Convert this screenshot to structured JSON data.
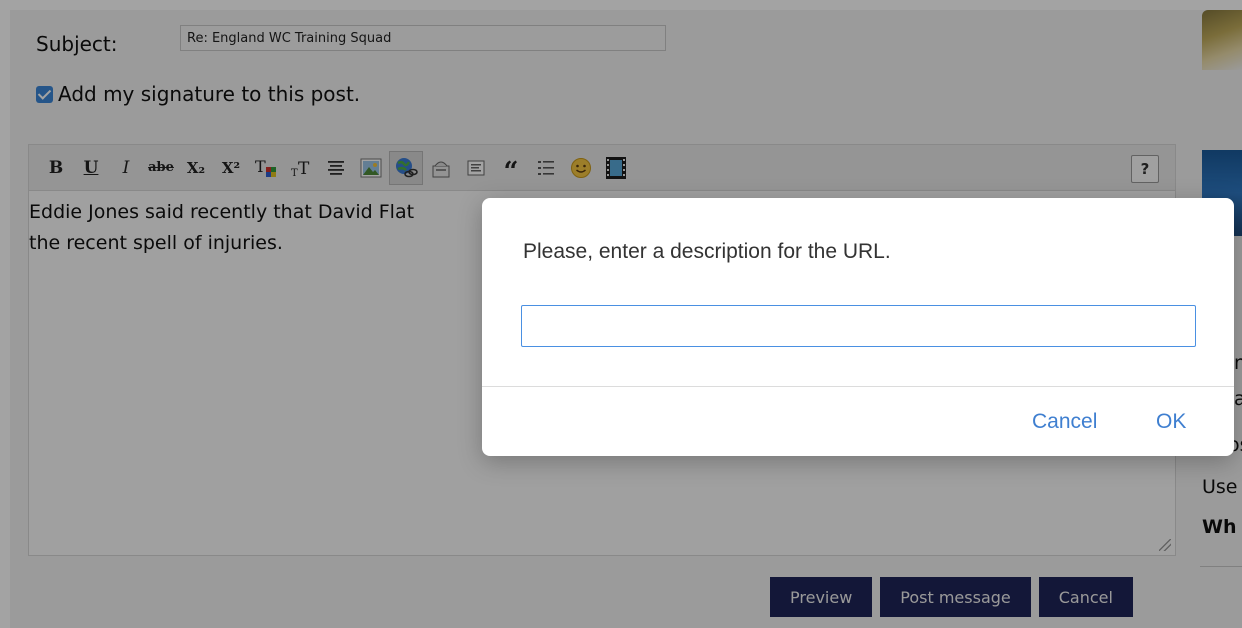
{
  "form": {
    "subject_label": "Subject:",
    "subject_value": "Re: England WC Training Squad",
    "signature_label": "Add my signature to this post."
  },
  "toolbar": {
    "bold": "B",
    "underline": "U",
    "italic": "I",
    "strike": "abe",
    "subscript": "X₂",
    "superscript": "X²",
    "help": "?"
  },
  "editor": {
    "line1": "Eddie Jones said recently that David Flat",
    "line2": "the recent spell of injuries."
  },
  "buttons": {
    "preview": "Preview",
    "post": "Post message",
    "cancel": "Cancel"
  },
  "sidebar": {
    "frag1": "n",
    "frag2": "a",
    "frag3": "os",
    "frag4": "Use",
    "frag5": "Wh"
  },
  "dialog": {
    "message": "Please, enter a description for the URL.",
    "input_value": "",
    "cancel_label": "Cancel",
    "ok_label": "OK"
  }
}
